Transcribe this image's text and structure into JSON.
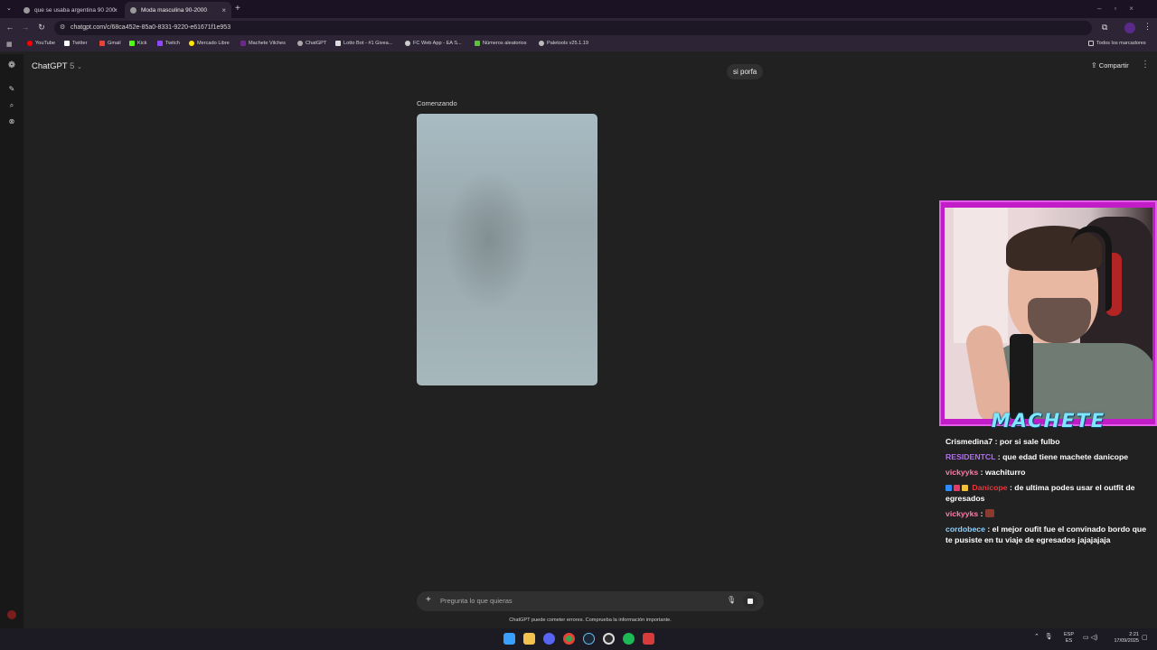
{
  "browser": {
    "tabs": [
      {
        "title": "que se usaba argentina 90 200",
        "active": false
      },
      {
        "title": "Moda masculina 90-2000",
        "active": true
      }
    ],
    "url": "chatgpt.com/c/68ca452e-85a0-8331-9220-e61671f1e953",
    "bookmarks": [
      {
        "label": "YouTube",
        "icon": "youtube-icon",
        "color": "#ff0000"
      },
      {
        "label": "Twitter",
        "icon": "x-icon",
        "color": "#ffffff"
      },
      {
        "label": "Gmail",
        "icon": "gmail-icon",
        "color": "#ea4335"
      },
      {
        "label": "Kick",
        "icon": "kick-icon",
        "color": "#53fc18"
      },
      {
        "label": "Twitch",
        "icon": "twitch-icon",
        "color": "#9146ff"
      },
      {
        "label": "Mercado Libre",
        "icon": "mercadolibre-icon",
        "color": "#ffe600"
      },
      {
        "label": "Machete Vilches",
        "icon": "channel-icon",
        "color": "#6a2a8a"
      },
      {
        "label": "ChatGPT",
        "icon": "chatgpt-icon",
        "color": "#aaaaaa"
      },
      {
        "label": "Lotto Bot - #1 Givea...",
        "icon": "grid-icon",
        "color": "#dddddd"
      },
      {
        "label": "FC Web App - EA S...",
        "icon": "ea-icon",
        "color": "#cccccc"
      },
      {
        "label": "Números aleatorios",
        "icon": "dice-icon",
        "color": "#5fbf3f"
      },
      {
        "label": "Paletools v25.1.19",
        "icon": "paletools-icon",
        "color": "#bbbbbb"
      }
    ],
    "all_bookmarks_label": "Todos los marcadores"
  },
  "chatgpt": {
    "model_name": "ChatGPT",
    "model_version": "5",
    "share_label": "Compartir",
    "user_message": "si porfa",
    "status_text": "Comenzando",
    "composer_placeholder": "Pregunta lo que quieras",
    "disclaimer": "ChatGPT puede cometer errores. Comprueba la información importante."
  },
  "stream": {
    "brand_name": "MACHETE",
    "chat": [
      {
        "user": "Crismedina7",
        "user_color": "#ffffff",
        "text": "por si sale fulbo",
        "badges": []
      },
      {
        "user": "RESIDENTCL",
        "user_color": "#b868ff",
        "text": "que edad tiene machete danicope",
        "badges": []
      },
      {
        "user": "vickyyks",
        "user_color": "#ff7bab",
        "text": "wachiturro",
        "badges": []
      },
      {
        "user": "Danicope",
        "user_color": "#e8353b",
        "text": "de ultima podes usar el outfit de egresados",
        "badges": [
          "#2f8cff",
          "#e53b6a",
          "#f0c23a"
        ]
      },
      {
        "user": "vickyyks",
        "user_color": "#ff7bab",
        "text": "",
        "badges": [],
        "emote": true
      },
      {
        "user": "cordobece",
        "user_color": "#8ed0ff",
        "text": "el mejor oufit fue el convinado bordo que te pusiste en tu viaje de egresados jajajajaja",
        "badges": []
      }
    ]
  },
  "taskbar": {
    "lang_line1": "ESP",
    "lang_line2": "ES",
    "time": "2:21",
    "date": "17/09/2025"
  }
}
